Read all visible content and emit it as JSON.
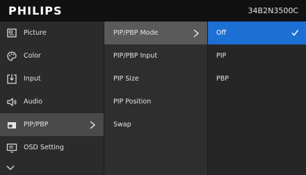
{
  "header": {
    "brand": "PHILIPS",
    "model": "34B2N3500C"
  },
  "menu": {
    "main_items": [
      {
        "label": "Picture",
        "icon": "picture-icon"
      },
      {
        "label": "Color",
        "icon": "palette-icon"
      },
      {
        "label": "Input",
        "icon": "input-icon"
      },
      {
        "label": "Audio",
        "icon": "speaker-icon"
      },
      {
        "label": "PIP/PBP",
        "icon": "pip-icon",
        "selected": true
      },
      {
        "label": "OSD Setting",
        "icon": "osd-icon"
      }
    ],
    "sub_items": [
      {
        "label": "PIP/PBP Mode",
        "selected": true
      },
      {
        "label": "PIP/PBP Input"
      },
      {
        "label": "PIP Size"
      },
      {
        "label": "PIP Position"
      },
      {
        "label": "Swap"
      }
    ],
    "options": [
      {
        "label": "Off",
        "selected": true
      },
      {
        "label": "PIP"
      },
      {
        "label": "PBP"
      }
    ]
  },
  "colors": {
    "header_bg": "#111111",
    "selected_option": "#1e6fd3"
  }
}
